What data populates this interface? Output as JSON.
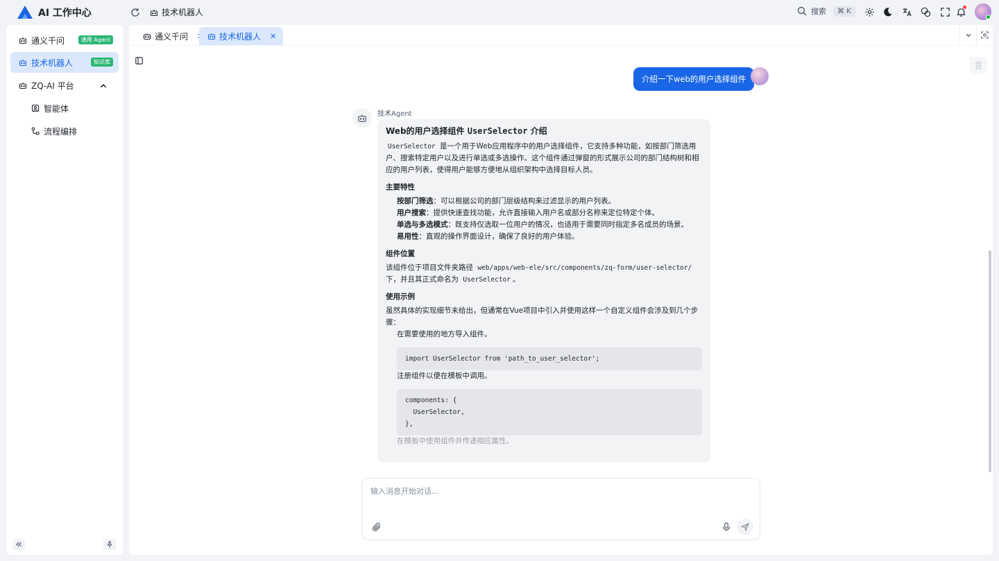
{
  "app": {
    "title": "AI 工作中心"
  },
  "header": {
    "breadcrumb": "技术机器人",
    "search_label": "搜索",
    "search_shortcut": "⌘ K",
    "icons": [
      "refresh-icon",
      "search-icon",
      "settings-icon",
      "moon-icon",
      "translate-icon",
      "theme-icon",
      "fullscreen-icon",
      "bell-icon",
      "avatar"
    ]
  },
  "sidebar": {
    "items": [
      {
        "label": "通义千问",
        "badge": "通用 Agent",
        "active": false
      },
      {
        "label": "技术机器人",
        "badge": "知识库",
        "active": true
      },
      {
        "label": "ZQ-AI 平台",
        "expanded": true
      },
      {
        "label": "智能体",
        "sub": true
      },
      {
        "label": "流程编排",
        "sub": true
      }
    ]
  },
  "tabs": [
    {
      "label": "通义千问",
      "close": "✕",
      "active": false
    },
    {
      "label": "技术机器人",
      "close": "✕",
      "active": true
    }
  ],
  "chat": {
    "user_message": "介绍一下web的用户选择组件",
    "bot_name": "技术Agent",
    "reply": {
      "title_prefix": "Web的用户选择组件",
      "title_code": "UserSelector",
      "title_suffix": "介绍",
      "intro_code": "UserSelector",
      "intro_text": "是一个用于Web应用程序中的用户选择组件，它支持多种功能，如按部门筛选用户、搜索特定用户以及进行单选或多选操作。这个组件通过弹窗的形式展示公司的部门结构树和相应的用户列表，使得用户能够方便地从组织架构中选择目标人员。",
      "features_heading": "主要特性",
      "features": [
        {
          "name": "按部门筛选",
          "desc": "：可以根据公司的部门层级结构来过滤显示的用户列表。"
        },
        {
          "name": "用户搜索",
          "desc": "：提供快速查找功能，允许直接输入用户名或部分名称来定位特定个体。"
        },
        {
          "name": "单选与多选模式",
          "desc": "：既支持仅选取一位用户的情况，也适用于需要同时指定多名成员的场景。"
        },
        {
          "name": "易用性",
          "desc": "：直观的操作界面设计，确保了良好的用户体验。"
        }
      ],
      "location_heading": "组件位置",
      "location_text1": "该组件位于项目文件夹路径",
      "location_path": "web/apps/web-ele/src/components/zq-form/user-selector/",
      "location_text2": "下，并且其正式命名为",
      "location_name": "UserSelector",
      "location_text3": "。",
      "usage_heading": "使用示例",
      "usage_intro": "虽然具体的实现细节未给出，但通常在Vue项目中引入并使用这样一个自定义组件会涉及到几个步骤：",
      "step1": "在需要使用的地方导入组件。",
      "code1": "import UserSelector from 'path_to_user_selector';",
      "step2": "注册组件以便在模板中调用。",
      "code2": "components: {\n  UserSelector,\n},",
      "step3_partial": "在模板中使用组件并传递相应属性。"
    }
  },
  "composer": {
    "placeholder": "输入消息开始对话..."
  }
}
